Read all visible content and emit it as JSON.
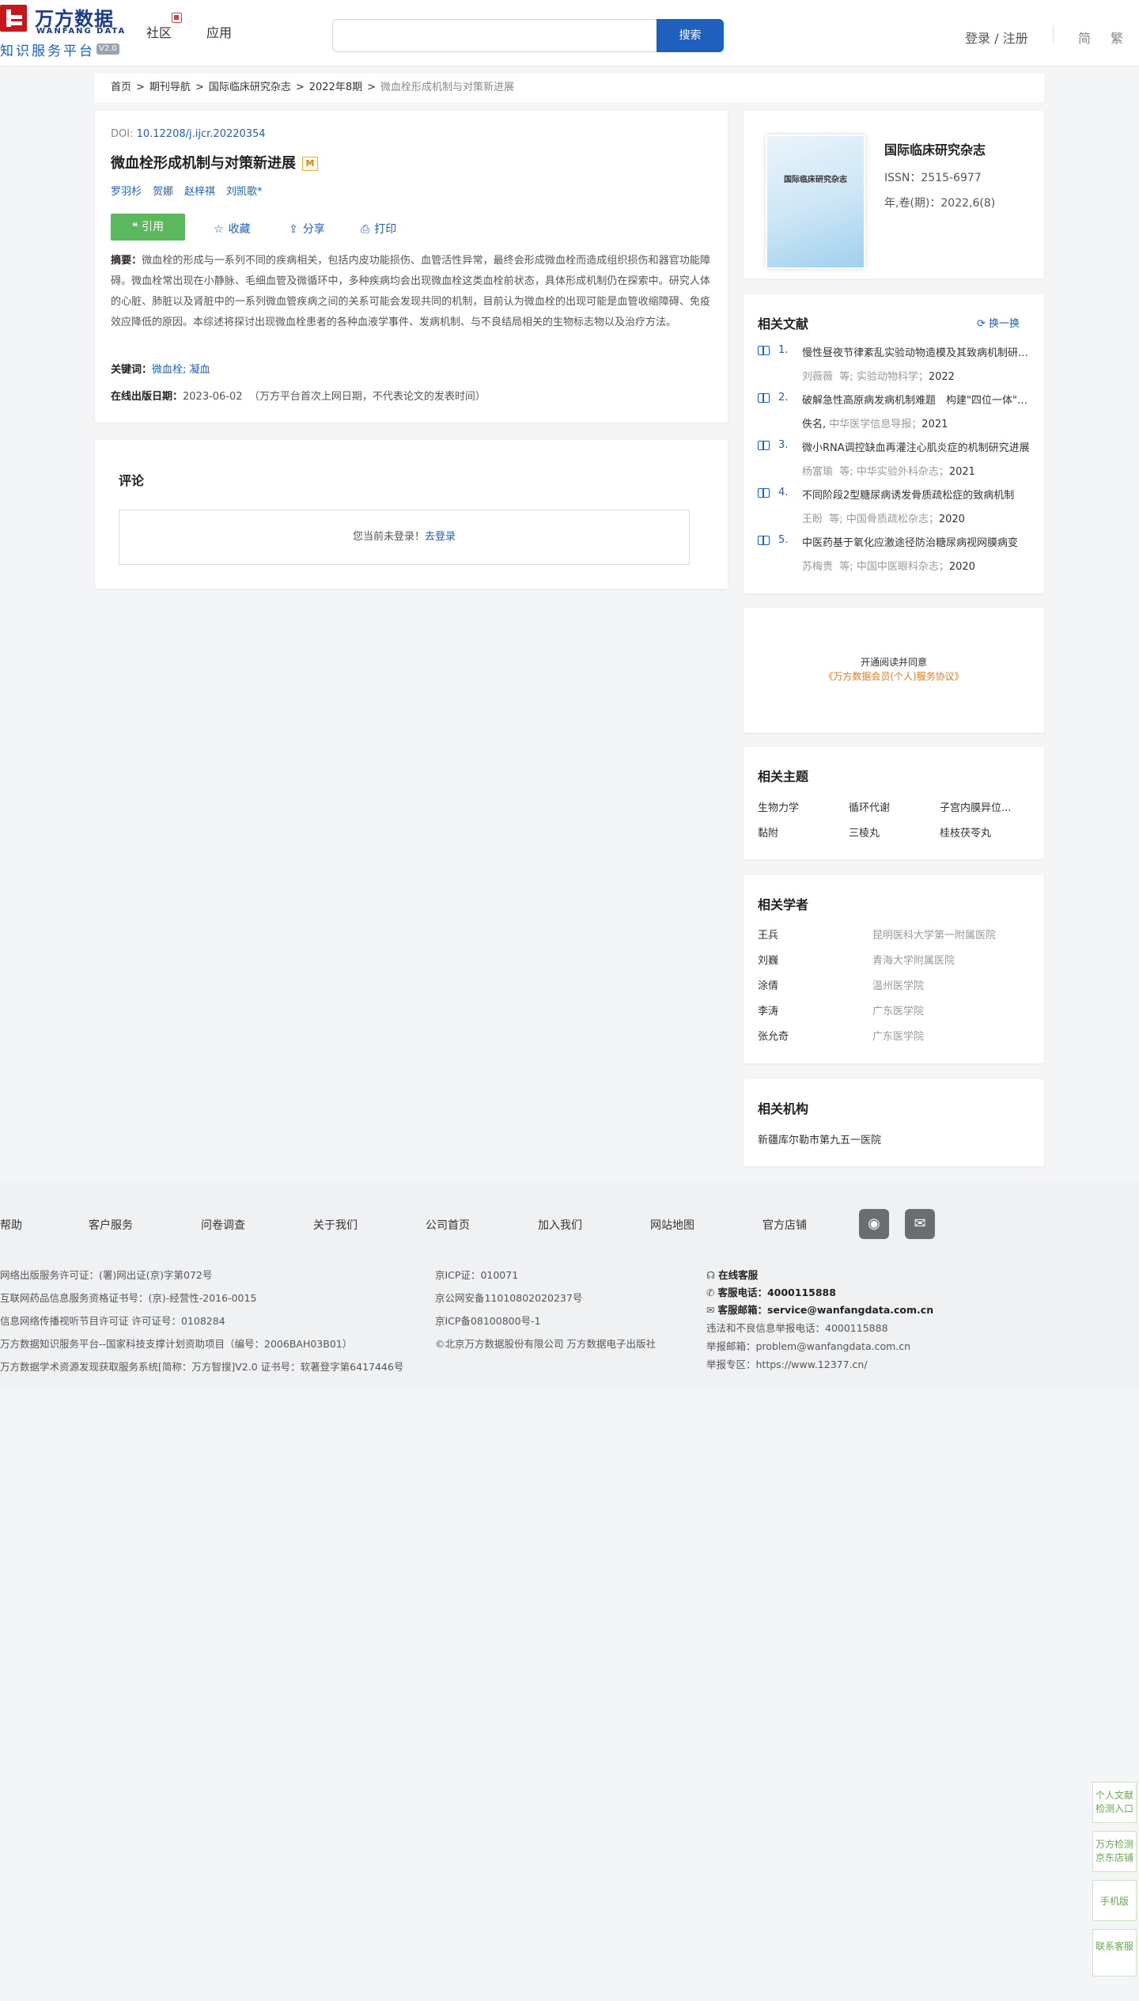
{
  "header": {
    "logo_cn": "万方数据",
    "logo_en": "WANFANG DATA",
    "logo_sub": "知识服务平台",
    "logo_ver": "V2.0",
    "nav": [
      "社区",
      "应用"
    ],
    "search_btn": "搜索",
    "login": "登录 / 注册",
    "lang_simple": "简",
    "lang_trad": "繁"
  },
  "breadcrumb": [
    "首页",
    "期刊导航",
    "国际临床研究杂志",
    "2022年8期",
    "微血栓形成机制与对策新进展"
  ],
  "article": {
    "doi_label": "DOI: ",
    "doi": "10.12208/j.ijcr.20220354",
    "title": "微血栓形成机制与对策新进展",
    "badge": "M",
    "authors": [
      "罗羽杉",
      "贺娜",
      "赵梓祺",
      "刘凯歌*"
    ],
    "cite": "❝ 引用",
    "collect": "收藏",
    "share": "分享",
    "print": "打印",
    "abstract_label": "摘要：",
    "abstract": "微血栓的形成与一系列不同的疾病相关，包括内皮功能损伤、血管活性异常，最终会形成微血栓而造成组织损伤和器官功能障碍。微血栓常出现在小静脉、毛细血管及微循环中，多种疾病均会出现微血栓这类血栓前状态，具体形成机制仍在探索中。研究人体的心脏、肺脏以及肾脏中的一系列微血管疾病之间的关系可能会发现共同的机制，目前认为微血栓的出现可能是血管收缩障碍、免疫效应降低的原因。本综述将探讨出现微血栓患者的各种血液学事件、发病机制、与不良结局相关的生物标志物以及治疗方法。",
    "kw_label": "关键词：",
    "keywords": "微血栓; 凝血",
    "pub_label": "在线出版日期：",
    "pub_date": "2023-06-02",
    "pub_note": "（万方平台首次上网日期，不代表论文的发表时间）"
  },
  "comment": {
    "title": "评论",
    "notice": "您当前未登录！",
    "login_link": "去登录"
  },
  "journal": {
    "cover_title": "国际临床研究杂志",
    "name": "国际临床研究杂志",
    "issn": "ISSN：2515-6977",
    "year": "年,卷(期)：2022,6(8)"
  },
  "related_docs": {
    "title": "相关文献",
    "refresh": "换一换",
    "items": [
      {
        "num": "1.",
        "title": "慢性昼夜节律紊乱实验动物造模及其致病机制研究进展",
        "author": "刘薇薇",
        "etc": "等;",
        "source": "实验动物科学；",
        "year": "2022"
      },
      {
        "num": "2.",
        "title": "破解急性高原病发病机制难题　构建\"四位一体\"防治体系",
        "author": "佚名,",
        "etc": "",
        "source": "中华医学信息导报；",
        "year": "2021"
      },
      {
        "num": "3.",
        "title": "微小RNA调控缺血再灌注心肌炎症的机制研究进展",
        "author": "杨富瑜",
        "etc": "等;",
        "source": "中华实验外科杂志；",
        "year": "2021"
      },
      {
        "num": "4.",
        "title": "不同阶段2型糖尿病诱发骨质疏松症的致病机制",
        "author": "王盼",
        "etc": "等;",
        "source": "中国骨质疏松杂志；",
        "year": "2020"
      },
      {
        "num": "5.",
        "title": "中医药基于氧化应激途径防治糖尿病视网膜病变",
        "author": "苏梅贵",
        "etc": "等;",
        "source": "中国中医眼科杂志；",
        "year": "2020"
      }
    ]
  },
  "ad": {
    "line1": "开通阅读并同意",
    "line2": "《万方数据会员(个人)服务协议》"
  },
  "topics": {
    "title": "相关主题",
    "items": [
      "生物力学",
      "循环代谢",
      "子宫内膜异位...",
      "黏附",
      "三棱丸",
      "桂枝茯苓丸"
    ]
  },
  "scholars": {
    "title": "相关学者",
    "items": [
      {
        "name": "王兵",
        "org": "昆明医科大学第一附属医院"
      },
      {
        "name": "刘巍",
        "org": "青海大学附属医院"
      },
      {
        "name": "涂倩",
        "org": "温州医学院"
      },
      {
        "name": "李涛",
        "org": "广东医学院"
      },
      {
        "name": "张允奇",
        "org": "广东医学院"
      }
    ]
  },
  "orgs": {
    "title": "相关机构",
    "item": "新疆库尔勒市第九五一医院"
  },
  "footer": {
    "nav": [
      "帮助",
      "客户服务",
      "问卷调查",
      "关于我们",
      "公司首页",
      "加入我们",
      "网站地图",
      "官方店铺"
    ],
    "col1": [
      "网络出版服务许可证：(署)网出证(京)字第072号",
      "互联网药品信息服务资格证书号：(京)-经营性-2016-0015",
      "信息网络传播视听节目许可证 许可证号：0108284",
      "万方数据知识服务平台--国家科技支撑计划资助项目（编号：2006BAH03B01）",
      "万方数据学术资源发现获取服务系统[简称：万方智搜]V2.0 证书号：软著登字第6417446号"
    ],
    "col2": [
      "京ICP证：010071",
      "京公网安备11010802020237号",
      "京ICP备08100800号-1",
      "©北京万方数据股份有限公司 万方数据电子出版社"
    ],
    "online": "在线客服",
    "phone_label": "客服电话：",
    "phone": "4000115888",
    "email_label": "客服邮箱：",
    "email": "service@wanfangdata.com.cn",
    "report_phone": "违法和不良信息举报电话：4000115888",
    "report_email": "举报邮箱：problem@wanfangdata.com.cn",
    "report_zone": "举报专区：https://www.12377.cn/"
  },
  "float": {
    "tab1": "个人文献检测入口",
    "tab2": "万方检测京东店铺",
    "tab3": "手机版",
    "tab4": "联系客服"
  },
  "colors": {
    "brand": "#1f5fbd",
    "cite": "#5cb85c",
    "logo_red": "#c8161d"
  }
}
